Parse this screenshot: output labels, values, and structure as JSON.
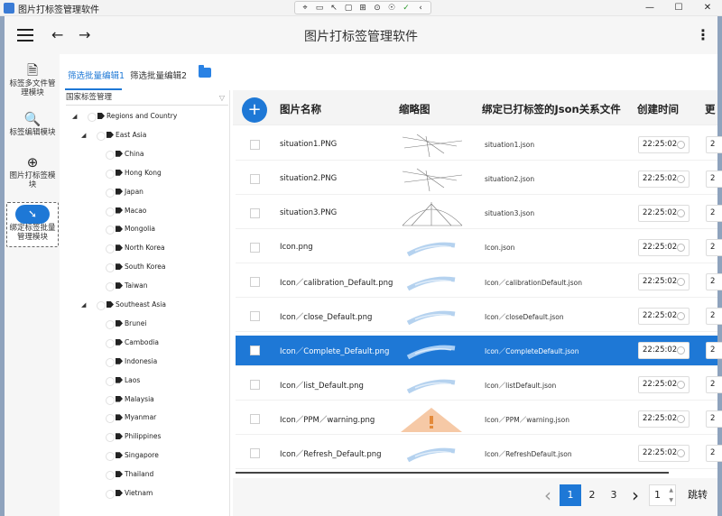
{
  "window": {
    "title": "图片打标签管理软件"
  },
  "appbar": {
    "title": "图片打标签管理软件"
  },
  "sidenav": [
    {
      "label": "标签多文件管理模块",
      "icon": "document-icon"
    },
    {
      "label": "标签编辑模块",
      "icon": "edit-document-icon"
    },
    {
      "label": "图片打标签模块",
      "icon": "add-tag-icon"
    },
    {
      "label": "绑定标签批量管理模块",
      "icon": "bind-tag-icon"
    }
  ],
  "tabs": [
    "筛选批量编辑1",
    "筛选批量编辑2"
  ],
  "tree": {
    "combo": "国家标签管理",
    "root": "Regions and Country",
    "groups": [
      {
        "name": "East Asia",
        "items": [
          "China",
          "Hong Kong",
          "Japan",
          "Macao",
          "Mongolia",
          "North Korea",
          "South Korea",
          "Taiwan"
        ]
      },
      {
        "name": "Southeast Asia",
        "items": [
          "Brunei",
          "Cambodia",
          "Indonesia",
          "Laos",
          "Malaysia",
          "Myanmar",
          "Philippines",
          "Singapore",
          "Thailand",
          "Vietnam"
        ]
      }
    ]
  },
  "grid": {
    "add_label": "+",
    "headers": [
      "图片名称",
      "缩略图",
      "绑定已打标签的Json关系文件",
      "创建时间",
      "更"
    ],
    "rows": [
      {
        "name": "situation1.PNG",
        "json": "situation1.json",
        "time": "22:25:02",
        "upd": "2",
        "selected": false,
        "thumb": "lines"
      },
      {
        "name": "situation2.PNG",
        "json": "situation2.json",
        "time": "22:25:02",
        "upd": "2",
        "selected": false,
        "thumb": "lines"
      },
      {
        "name": "situation3.PNG",
        "json": "situation3.json",
        "time": "22:25:02",
        "upd": "2",
        "selected": false,
        "thumb": "arc"
      },
      {
        "name": "Icon.png",
        "json": "Icon.json",
        "time": "22:25:02",
        "upd": "2",
        "selected": false,
        "thumb": "blur"
      },
      {
        "name": "Icon／calibration_Default.png",
        "json": "Icon／calibrationDefault.json",
        "time": "22:25:02",
        "upd": "2",
        "selected": false,
        "thumb": "blur"
      },
      {
        "name": "Icon／close_Default.png",
        "json": "Icon／closeDefault.json",
        "time": "22:25:02",
        "upd": "2",
        "selected": false,
        "thumb": "blur"
      },
      {
        "name": "Icon／Complete_Default.png",
        "json": "Icon／CompleteDefault.json",
        "time": "22:25:02",
        "upd": "2",
        "selected": true,
        "thumb": "blur"
      },
      {
        "name": "Icon／list_Default.png",
        "json": "Icon／listDefault.json",
        "time": "22:25:02",
        "upd": "2",
        "selected": false,
        "thumb": "blur"
      },
      {
        "name": "Icon／PPM／warning.png",
        "json": "Icon／PPM／warning.json",
        "time": "22:25:02",
        "upd": "2",
        "selected": false,
        "thumb": "warning"
      },
      {
        "name": "Icon／Refresh_Default.png",
        "json": "Icon／RefreshDefault.json",
        "time": "22:25:02",
        "upd": "2",
        "selected": false,
        "thumb": "blur"
      }
    ]
  },
  "pager": {
    "prev": "‹",
    "pages": [
      "1",
      "2",
      "3"
    ],
    "current": "1",
    "next": "›",
    "input": "1",
    "go": "跳转"
  },
  "colors": {
    "accent": "#1e78d6"
  }
}
